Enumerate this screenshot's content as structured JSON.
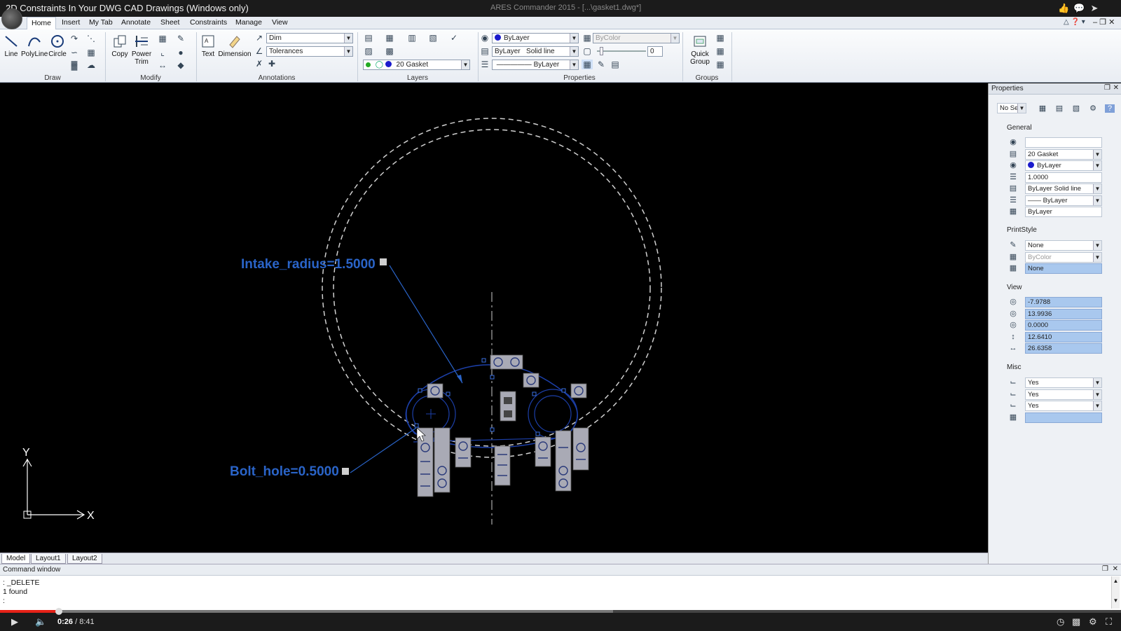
{
  "window": {
    "video_title": "2D Constraints In Your DWG CAD Drawings (Windows only)",
    "app_title": "ARES Commander 2015 - [...\\gasket1.dwg*]"
  },
  "tabs": [
    "Home",
    "Insert",
    "My Tab",
    "Annotate",
    "Sheet",
    "Constraints",
    "Manage",
    "View"
  ],
  "draw": {
    "line": "Line",
    "polyline": "PolyLine",
    "circle": "Circle",
    "label": "Draw"
  },
  "modify": {
    "copy": "Copy",
    "power_trim": "Power",
    "power_trim2": "Trim",
    "label": "Modify"
  },
  "annotations": {
    "text": "Text",
    "dimension": "Dimension",
    "dim_style": "Dim",
    "tolerances": "Tolerances",
    "label": "Annotations"
  },
  "layers": {
    "current_layer": "20 Gasket",
    "label": "Layers"
  },
  "properties": {
    "color": "ByLayer",
    "linestyle": "ByLayer",
    "linestyle_type": "Solid line",
    "lineweight": "ByLayer",
    "printstyle": "ByColor",
    "transparency": "0",
    "label": "Properties"
  },
  "groups": {
    "quick_group": "Quick",
    "quick_group2": "Group",
    "label": "Groups"
  },
  "drawing": {
    "intake_label": "Intake_radius=1.5000",
    "bolt_label": "Bolt_hole=0.5000",
    "axis_y": "Y",
    "axis_x": "X",
    "colors": {
      "constraint_blue": "#1c3fa8",
      "annot_blue": "#2a64c8",
      "dashed": "#cfcfcf"
    }
  },
  "layout_tabs": [
    "Model",
    "Layout1",
    "Layout2"
  ],
  "props_panel": {
    "title": "Properties",
    "selection": "No Sele",
    "general_title": "General",
    "general": [
      "",
      "20 Gasket",
      "ByLayer",
      "1.0000",
      "ByLayer    Solid line",
      "—— ByLayer",
      "ByLayer"
    ],
    "printstyle_title": "PrintStyle",
    "printstyle": [
      "None",
      "ByColor",
      "None"
    ],
    "view_title": "View",
    "view": [
      "-7.9788",
      "13.9936",
      "0.0000",
      "12.6410",
      "26.6358"
    ],
    "misc_title": "Misc",
    "misc": [
      "Yes",
      "Yes",
      "Yes",
      ""
    ]
  },
  "command": {
    "title": "Command window",
    "lines": [
      ": _DELETE",
      "1 found",
      ":"
    ]
  },
  "player": {
    "current": "0:26",
    "total": "8:41",
    "separator": " / ",
    "progress_fraction": 0.0525,
    "loaded_fraction": 0.547
  }
}
